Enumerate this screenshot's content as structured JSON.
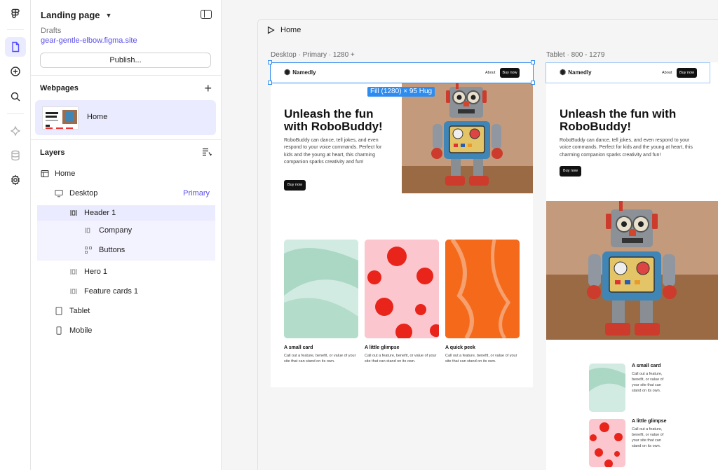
{
  "sidebar": {
    "title": "Landing page",
    "drafts_label": "Drafts",
    "site_url": "gear-gentle-elbow.figma.site",
    "publish_label": "Publish...",
    "webpages_heading": "Webpages",
    "page_name": "Home",
    "layers_heading": "Layers",
    "layers": [
      {
        "label": "Home"
      },
      {
        "label": "Desktop",
        "badge": "Primary"
      },
      {
        "label": "Header 1"
      },
      {
        "label": "Company"
      },
      {
        "label": "Buttons"
      },
      {
        "label": "Hero 1"
      },
      {
        "label": "Feature cards 1"
      },
      {
        "label": "Tablet"
      },
      {
        "label": "Mobile"
      }
    ]
  },
  "canvas": {
    "play_label": "Home",
    "desktop_label": "Desktop · Primary · 1280 +",
    "tablet_label": "Tablet · 800 - 1279",
    "dimension_tag": "Fill (1280) × 95 Hug"
  },
  "site": {
    "logo": "Namedly",
    "nav_about": "About",
    "nav_buy": "Buy now",
    "hero_title": "Unleash the fun with RoboBuddy!",
    "hero_body": "RoboBuddy can dance, tell jokes, and even respond to your voice commands. Perfect for kids and the young at heart, this charming companion sparks creativity and fun!",
    "hero_buy": "Buy now",
    "cards": [
      {
        "title": "A small card",
        "desc": "Call out a feature, benefit, or value of your site that can stand on its own."
      },
      {
        "title": "A little glimpse",
        "desc": "Call out a feature, benefit, or value of your site that can stand on its own."
      },
      {
        "title": "A quick peek",
        "desc": "Call out a feature, benefit, or value of your site that can stand on its own."
      }
    ]
  },
  "colors": {
    "accent": "#5551ff",
    "selection": "#2d8cf0"
  }
}
